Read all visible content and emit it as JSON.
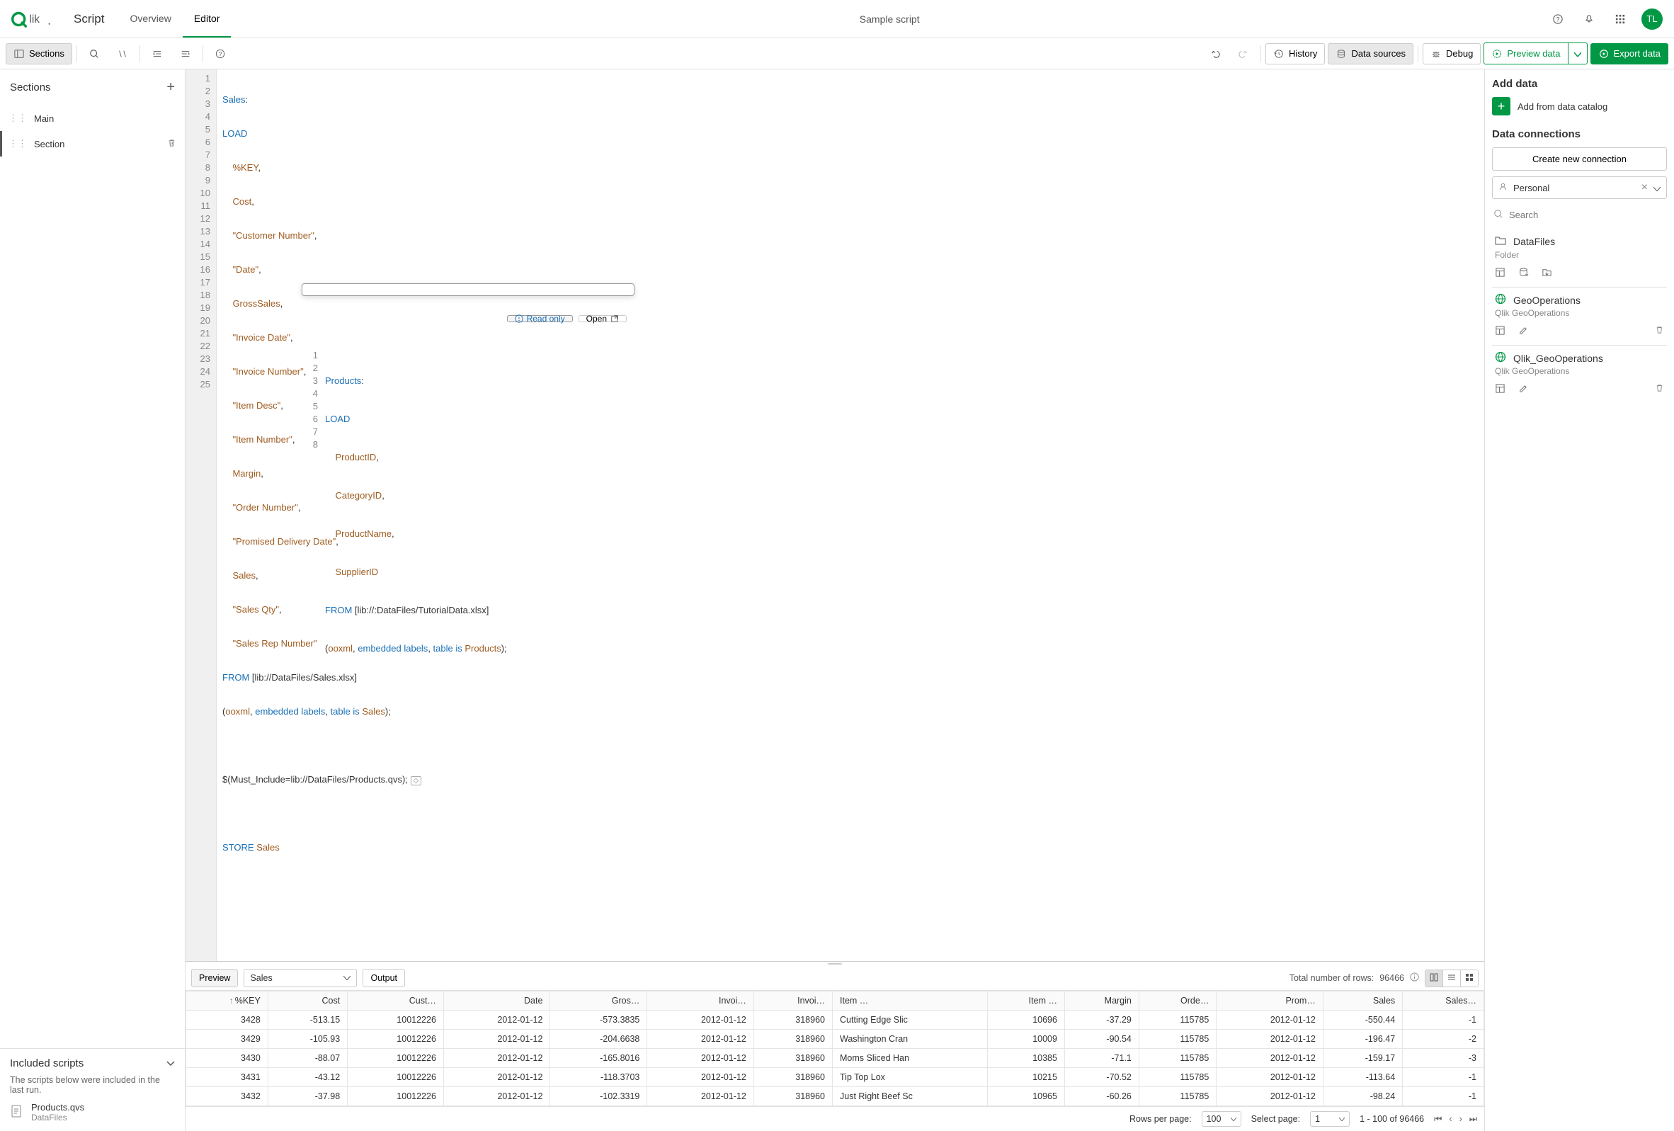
{
  "header": {
    "app_title": "Script",
    "nav": {
      "overview": "Overview",
      "editor": "Editor"
    },
    "center_title": "Sample script",
    "avatar": "TL"
  },
  "toolbar": {
    "sections": "Sections",
    "history": "History",
    "data_sources": "Data sources",
    "debug": "Debug",
    "preview": "Preview data",
    "export": "Export data"
  },
  "sidebar": {
    "title": "Sections",
    "items": [
      {
        "label": "Main"
      },
      {
        "label": "Section"
      }
    ],
    "included": {
      "title": "Included scripts",
      "note": "The scripts below were included in the last run.",
      "script_name": "Products.qvs",
      "script_sub": "DataFiles"
    }
  },
  "editor": {
    "lines": 25,
    "code1": {
      "l1a": "Sales",
      "l1b": ":",
      "l2": "LOAD",
      "l3a": "    %KEY",
      "l3b": ",",
      "l4a": "    Cost",
      "l4b": ",",
      "l5a": "    \"Customer Number\"",
      "l5b": ",",
      "l6a": "    \"Date\"",
      "l6b": ",",
      "l7a": "    GrossSales",
      "l7b": ",",
      "l8a": "    \"Invoice Date\"",
      "l8b": ",",
      "l9a": "    \"Invoice Number\"",
      "l9b": ",",
      "l10a": "    \"Item Desc\"",
      "l10b": ",",
      "l11a": "    \"Item Number\"",
      "l11b": ",",
      "l12a": "    Margin",
      "l12b": ",",
      "l13a": "    \"Order Number\"",
      "l13b": ",",
      "l14a": "    \"Promised Delivery Date\"",
      "l14b": ",",
      "l15a": "    Sales",
      "l15b": ",",
      "l16a": "    \"Sales Qty\"",
      "l16b": ",",
      "l17a": "    \"Sales Rep Number\"",
      "l18a": "FROM",
      "l18b": " [lib://DataFiles/Sales.xlsx]",
      "l19a": "(",
      "l19b": "ooxml",
      "l19c": ", ",
      "l19d": "embedded",
      "l19e": " ",
      "l19f": "labels",
      "l19g": ", ",
      "l19h": "table",
      "l19i": " ",
      "l19j": "is",
      "l19k": " ",
      "l19l": "Sales",
      "l19m": ");",
      "l21": "$(Must_Include=lib://DataFiles/Products.qvs);",
      "l23a": "STORE",
      "l23b": " ",
      "l23c": "Sales"
    },
    "popup": {
      "readonly": "Read only",
      "open": "Open",
      "l1a": "Products",
      "l1b": ":",
      "l2": "LOAD",
      "l3a": "    ProductID",
      "l3b": ",",
      "l4a": "    CategoryID",
      "l4b": ",",
      "l5a": "    ProductName",
      "l5b": ",",
      "l6a": "    SupplierID",
      "l7a": "FROM",
      "l7b": " [lib://:DataFiles/TutorialData.xlsx]",
      "l8a": "(",
      "l8b": "ooxml",
      "l8c": ", ",
      "l8d": "embedded",
      "l8e": " ",
      "l8f": "labels",
      "l8g": ", ",
      "l8h": "table",
      "l8i": " ",
      "l8j": "is",
      "l8k": " ",
      "l8l": "Products",
      "l8m": ");"
    }
  },
  "right": {
    "add_title": "Add data",
    "add_catalog": "Add from data catalog",
    "conn_title": "Data connections",
    "create_conn": "Create new connection",
    "selector": "Personal",
    "search_placeholder": "Search",
    "datafiles": "DataFiles",
    "folder_label": "Folder",
    "geo1": "GeoOperations",
    "geo1_sub": "Qlik GeoOperations",
    "geo2": "Qlik_GeoOperations",
    "geo2_sub": "Qlik GeoOperations"
  },
  "preview": {
    "tab_preview": "Preview",
    "selector": "Sales",
    "tab_output": "Output",
    "total_label": "Total number of rows:",
    "total_value": "96466",
    "columns": [
      "%KEY",
      "Cost",
      "Cust…",
      "Date",
      "Gros…",
      "Invoi…",
      "Invoi…",
      "Item …",
      "Item …",
      "Margin",
      "Orde…",
      "Prom…",
      "Sales",
      "Sales…"
    ],
    "rows": [
      [
        "3428",
        "-513.15",
        "10012226",
        "2012-01-12",
        "-573.3835",
        "2012-01-12",
        "318960",
        "Cutting Edge Slic",
        "10696",
        "-37.29",
        "115785",
        "2012-01-12",
        "-550.44",
        "-1"
      ],
      [
        "3429",
        "-105.93",
        "10012226",
        "2012-01-12",
        "-204.6638",
        "2012-01-12",
        "318960",
        "Washington Cran",
        "10009",
        "-90.54",
        "115785",
        "2012-01-12",
        "-196.47",
        "-2"
      ],
      [
        "3430",
        "-88.07",
        "10012226",
        "2012-01-12",
        "-165.8016",
        "2012-01-12",
        "318960",
        "Moms Sliced Han",
        "10385",
        "-71.1",
        "115785",
        "2012-01-12",
        "-159.17",
        "-3"
      ],
      [
        "3431",
        "-43.12",
        "10012226",
        "2012-01-12",
        "-118.3703",
        "2012-01-12",
        "318960",
        "Tip Top Lox",
        "10215",
        "-70.52",
        "115785",
        "2012-01-12",
        "-113.64",
        "-1"
      ],
      [
        "3432",
        "-37.98",
        "10012226",
        "2012-01-12",
        "-102.3319",
        "2012-01-12",
        "318960",
        "Just Right Beef Sc",
        "10965",
        "-60.26",
        "115785",
        "2012-01-12",
        "-98.24",
        "-1"
      ]
    ],
    "rows_per_page_label": "Rows per page:",
    "rows_per_page_value": "100",
    "select_page_label": "Select page:",
    "select_page_value": "1",
    "range": "1 - 100 of 96466"
  }
}
